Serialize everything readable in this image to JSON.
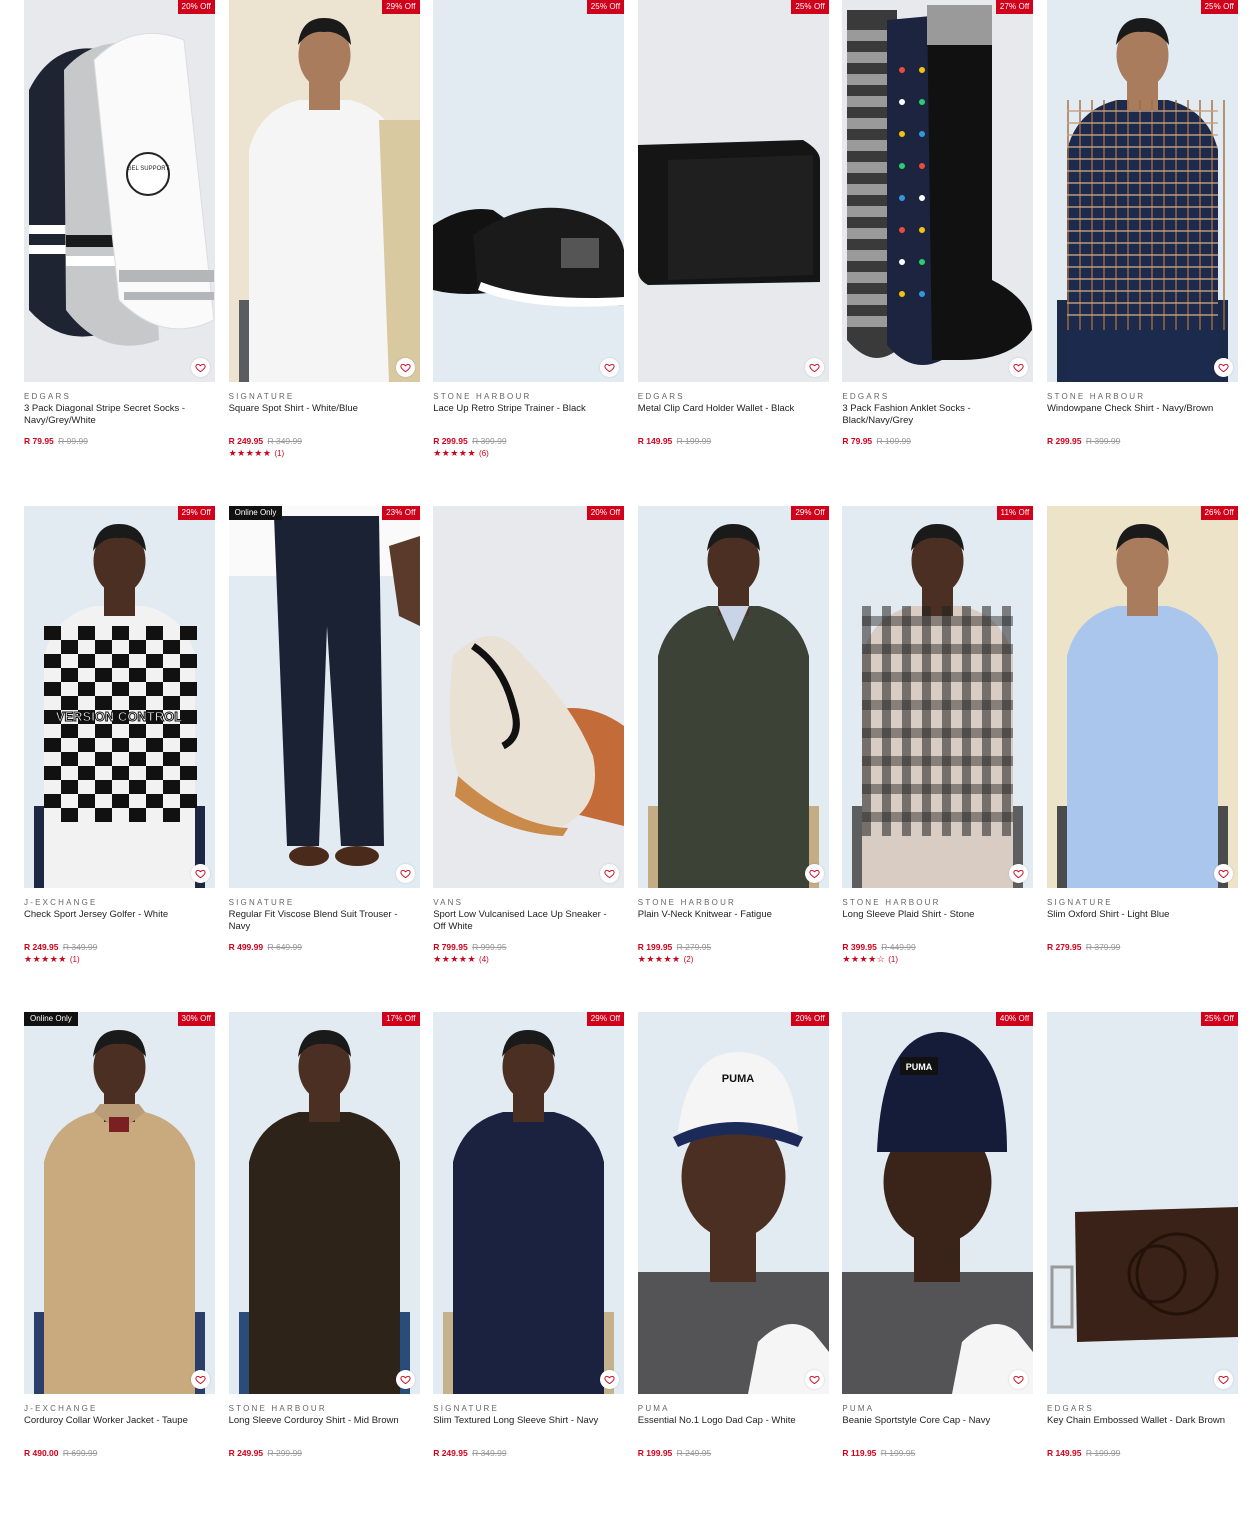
{
  "products": [
    {
      "brand": "EDGARS",
      "name": "3 Pack Diagonal Stripe Secret Socks - Navy/Grey/White",
      "price": "R 79.95",
      "was": "R 99.99",
      "discount": "20% Off",
      "online": "",
      "rating": "",
      "count": "",
      "img": "socks-white"
    },
    {
      "brand": "SIGNATURE",
      "name": "Square Spot Shirt - White/Blue",
      "price": "R 249.95",
      "was": "R 349.99",
      "discount": "29% Off",
      "online": "",
      "rating": "★★★★★",
      "count": "(1)",
      "img": "white-shirt"
    },
    {
      "brand": "STONE HARBOUR",
      "name": "Lace Up Retro Stripe Trainer - Black",
      "price": "R 299.95",
      "was": "R 399.99",
      "discount": "25% Off",
      "online": "",
      "rating": "★★★★★",
      "count": "(6)",
      "img": "black-trainer"
    },
    {
      "brand": "EDGARS",
      "name": "Metal Clip Card Holder Wallet - Black",
      "price": "R 149.95",
      "was": "R 199.99",
      "discount": "25% Off",
      "online": "",
      "rating": "",
      "count": "",
      "img": "black-wallet"
    },
    {
      "brand": "EDGARS",
      "name": "3 Pack Fashion Anklet Socks - Black/Navy/Grey",
      "price": "R 79.95",
      "was": "R 109.99",
      "discount": "27% Off",
      "online": "",
      "rating": "",
      "count": "",
      "img": "dot-socks"
    },
    {
      "brand": "STONE HARBOUR",
      "name": "Windowpane Check Shirt - Navy/Brown",
      "price": "R 299.95",
      "was": "R 399.99",
      "discount": "25% Off",
      "online": "",
      "rating": "",
      "count": "",
      "img": "check-shirt"
    },
    {
      "brand": "J-EXCHANGE",
      "name": "Check Sport Jersey Golfer - White",
      "price": "R 249.95",
      "was": "R 349.99",
      "discount": "29% Off",
      "online": "",
      "rating": "★★★★★",
      "count": "(1)",
      "img": "checker-golfer"
    },
    {
      "brand": "SIGNATURE",
      "name": "Regular Fit Viscose Blend Suit Trouser - Navy",
      "price": "R 499.99",
      "was": "R 649.99",
      "discount": "23% Off",
      "online": "Online Only",
      "rating": "",
      "count": "",
      "img": "trouser"
    },
    {
      "brand": "VANS",
      "name": "Sport Low Vulcanised Lace Up Sneaker - Off White",
      "price": "R 799.95",
      "was": "R 999.95",
      "discount": "20% Off",
      "online": "",
      "rating": "★★★★★",
      "count": "(4)",
      "img": "vans"
    },
    {
      "brand": "STONE HARBOUR",
      "name": "Plain V-Neck Knitwear - Fatigue",
      "price": "R 199.95",
      "was": "R 279.95",
      "discount": "29% Off",
      "online": "",
      "rating": "★★★★★",
      "count": "(2)",
      "img": "knit"
    },
    {
      "brand": "STONE HARBOUR",
      "name": "Long Sleeve Plaid Shirt - Stone",
      "price": "R 399.95",
      "was": "R 449.99",
      "discount": "11% Off",
      "online": "",
      "rating": "★★★★☆",
      "count": "(1)",
      "img": "plaid"
    },
    {
      "brand": "SIGNATURE",
      "name": "Slim Oxford Shirt - Light Blue",
      "price": "R 279.95",
      "was": "R 379.99",
      "discount": "26% Off",
      "online": "",
      "rating": "",
      "count": "",
      "img": "oxford"
    },
    {
      "brand": "J-EXCHANGE",
      "name": "Corduroy Collar Worker Jacket - Taupe",
      "price": "R 490.00",
      "was": "R 699.99",
      "discount": "30% Off",
      "online": "Online Only",
      "rating": "",
      "count": "",
      "img": "jacket"
    },
    {
      "brand": "STONE HARBOUR",
      "name": "Long Sleeve Corduroy Shirt - Mid Brown",
      "price": "R 249.95",
      "was": "R 299.99",
      "discount": "17% Off",
      "online": "",
      "rating": "",
      "count": "",
      "img": "cord-shirt"
    },
    {
      "brand": "SIGNATURE",
      "name": "Slim Textured Long Sleeve Shirt - Navy",
      "price": "R 249.95",
      "was": "R 349.99",
      "discount": "29% Off",
      "online": "",
      "rating": "",
      "count": "",
      "img": "navy-shirt"
    },
    {
      "brand": "PUMA",
      "name": "Essential No.1 Logo Dad Cap - White",
      "price": "R 199.95",
      "was": "R 249.95",
      "discount": "20% Off",
      "online": "",
      "rating": "",
      "count": "",
      "img": "cap"
    },
    {
      "brand": "PUMA",
      "name": "Beanie Sportstyle Core Cap - Navy",
      "price": "R 119.95",
      "was": "R 199.95",
      "discount": "40% Off",
      "online": "",
      "rating": "",
      "count": "",
      "img": "beanie"
    },
    {
      "brand": "EDGARS",
      "name": "Key Chain Embossed Wallet - Dark Brown",
      "price": "R 149.95",
      "was": "R 199.99",
      "discount": "25% Off",
      "online": "",
      "rating": "",
      "count": "",
      "img": "brown-wallet"
    }
  ],
  "image_labels": {
    "socks_print": "GEL SUPPORT",
    "golfer_print": "VERSION CONTROL",
    "puma_logo": "PUMA"
  },
  "colors": {
    "sale_red": "#d0021b",
    "online_badge": "#111111"
  }
}
